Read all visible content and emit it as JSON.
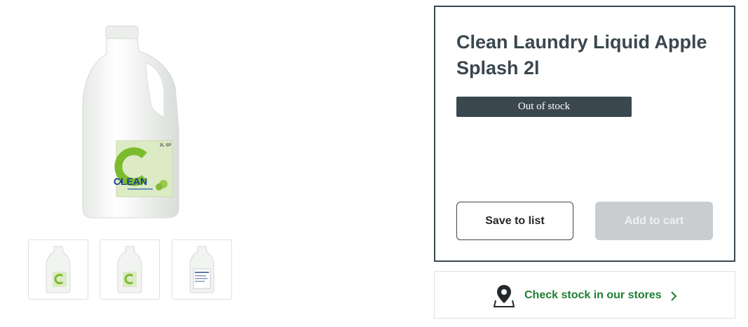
{
  "product": {
    "title": "Clean Laundry Liquid Apple Splash 2l",
    "stock_status": "Out of stock",
    "bottle_label_brand": "CLEAN",
    "bottle_label_size": "2L SP"
  },
  "actions": {
    "save_label": "Save to list",
    "cart_label": "Add to cart"
  },
  "store_check": {
    "label": "Check stock in our stores"
  },
  "colors": {
    "panel_border": "#3a474e",
    "badge_bg": "#3a474e",
    "disabled_button": "#c9cdd0",
    "link_green": "#1e7e34"
  },
  "icons": {
    "location": "map-pin-icon",
    "chevron": "chevron-right-icon"
  }
}
